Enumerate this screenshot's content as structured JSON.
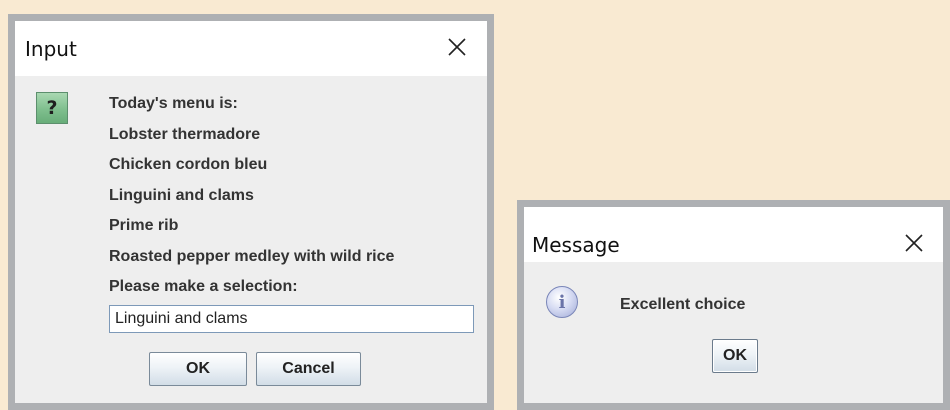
{
  "input_dialog": {
    "title": "Input",
    "icon": "question-icon",
    "icon_glyph": "?",
    "message_lines": [
      "Today's menu is:",
      "Lobster thermadore",
      "Chicken cordon bleu",
      "Linguini and clams",
      "Prime rib",
      "Roasted pepper medley with wild rice",
      "Please make a selection:"
    ],
    "input_value": "Linguini and clams",
    "ok_label": "OK",
    "cancel_label": "Cancel"
  },
  "message_dialog": {
    "title": "Message",
    "icon": "info-icon",
    "icon_glyph": "i",
    "message": "Excellent choice",
    "ok_label": "OK"
  },
  "colors": {
    "background": "#f9ead2",
    "dialog_border": "#aeb0b3",
    "dialog_body": "#eeeeee",
    "titlebar": "#ffffff"
  }
}
